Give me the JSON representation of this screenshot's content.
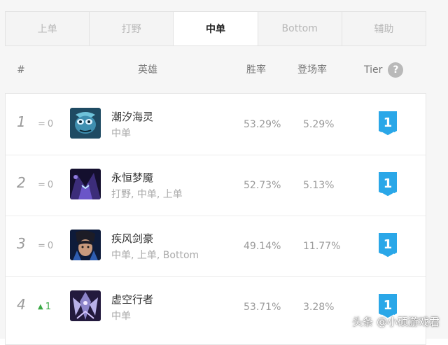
{
  "tabs": [
    {
      "label": "上单",
      "active": false
    },
    {
      "label": "打野",
      "active": false
    },
    {
      "label": "中单",
      "active": true
    },
    {
      "label": "Bottom",
      "active": false
    },
    {
      "label": "辅助",
      "active": false
    }
  ],
  "header": {
    "rank": "#",
    "hero": "英雄",
    "win_rate": "胜率",
    "pick_rate": "登场率",
    "tier": "Tier",
    "help_icon": "?"
  },
  "rows": [
    {
      "rank": "1",
      "trend_symbol": "=",
      "trend_value": "0",
      "trend_dir": "same",
      "avatar_icon": "fizz-portrait",
      "name": "潮汐海灵",
      "positions": "中单",
      "win_rate": "53.29%",
      "pick_rate": "5.29%",
      "tier": "1"
    },
    {
      "rank": "2",
      "trend_symbol": "=",
      "trend_value": "0",
      "trend_dir": "same",
      "avatar_icon": "nocturne-portrait",
      "name": "永恒梦魇",
      "positions": "打野, 中单, 上单",
      "win_rate": "52.73%",
      "pick_rate": "5.13%",
      "tier": "1"
    },
    {
      "rank": "3",
      "trend_symbol": "=",
      "trend_value": "0",
      "trend_dir": "same",
      "avatar_icon": "yasuo-portrait",
      "name": "疾风剑豪",
      "positions": "中单, 上单, Bottom",
      "win_rate": "49.14%",
      "pick_rate": "11.77%",
      "tier": "1"
    },
    {
      "rank": "4",
      "trend_symbol": "▲",
      "trend_value": "1",
      "trend_dir": "up",
      "avatar_icon": "kassadin-portrait",
      "name": "虚空行者",
      "positions": "中单",
      "win_rate": "53.71%",
      "pick_rate": "3.28%",
      "tier": "1"
    }
  ],
  "colors": {
    "tier_badge": "#2aa7e8",
    "trend_up": "#3aa845",
    "active_tab_text": "#222222"
  },
  "watermark": "头条 @小硕游戏君"
}
